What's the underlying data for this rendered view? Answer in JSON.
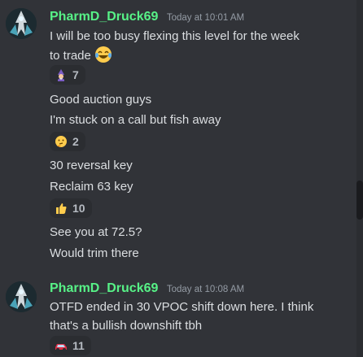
{
  "colors": {
    "background": "#313338",
    "username": "#57f287",
    "timestamp": "#949ba4",
    "text": "#dbdee1",
    "reaction_bg": "#2b2d31"
  },
  "messages": [
    {
      "username": "PharmD_Druck69",
      "timestamp": "Today at 10:01 AM",
      "avatar_icon": "wizard-avatar-icon",
      "lines": [
        "I will be too busy flexing this level for the week",
        "to trade"
      ],
      "inline_emoji": "laughing-crying-emoji",
      "reaction": {
        "emoji": "wizard-emoji",
        "count": "7"
      },
      "followups": [
        {
          "lines": [
            "Good auction guys"
          ]
        },
        {
          "lines": [
            "I'm stuck on a call but fish away"
          ],
          "reaction": {
            "emoji": "thinking-face-emoji",
            "count": "2"
          }
        },
        {
          "lines": [
            "30 reversal key"
          ]
        },
        {
          "lines": [
            "Reclaim 63 key"
          ],
          "reaction": {
            "emoji": "thumbs-up-emoji",
            "count": "10"
          }
        },
        {
          "lines": [
            "See you at 72.5?"
          ]
        },
        {
          "lines": [
            "Would trim there"
          ]
        }
      ]
    },
    {
      "username": "PharmD_Druck69",
      "timestamp": "Today at 10:08 AM",
      "avatar_icon": "wizard-avatar-icon",
      "lines": [
        "OTFD ended in 30 VPOC shift down here. I think",
        "that's a bullish downshift tbh"
      ],
      "reaction": {
        "emoji": "red-car-emoji",
        "count": "11"
      }
    }
  ]
}
